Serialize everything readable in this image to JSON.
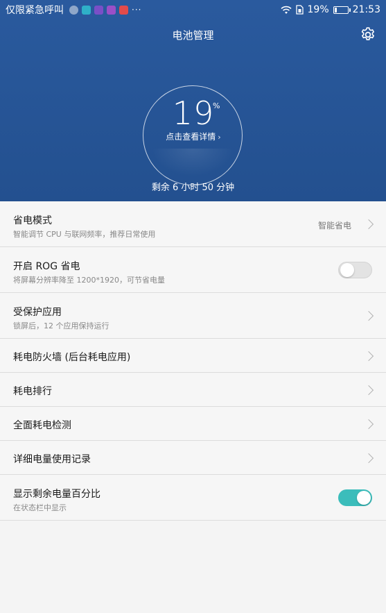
{
  "status_bar": {
    "carrier": "仅限紧急呼叫",
    "notification_icons": [
      {
        "name": "vpn-icon",
        "color": "#8fa7c9"
      },
      {
        "name": "app-icon-teal",
        "color": "#2fb0c8"
      },
      {
        "name": "app-icon-purple",
        "color": "#7a4fc7"
      },
      {
        "name": "app-icon-violet",
        "color": "#9b4fc7"
      },
      {
        "name": "app-icon-red",
        "color": "#e24b4b"
      }
    ],
    "more": "···",
    "battery_percent": "19%",
    "battery_level": 0.19,
    "time": "21:53"
  },
  "header": {
    "title": "电池管理",
    "battery_value": "19",
    "percent_sign": "%",
    "detail_link": "点击查看详情",
    "detail_chevron": "›",
    "remaining": "剩余 6 小时 50 分钟",
    "accent_color": "#2a5a9e"
  },
  "settings": {
    "power_saving_mode": {
      "title": "省电模式",
      "subtitle": "智能调节 CPU 与联网频率，推荐日常使用",
      "value": "智能省电"
    },
    "rog": {
      "title": "开启 ROG 省电",
      "subtitle": "将屏幕分辨率降至 1200*1920，可节省电量",
      "enabled": false
    },
    "protected_apps": {
      "title": "受保护应用",
      "subtitle": "锁屏后，12 个应用保持运行"
    },
    "firewall": {
      "title": "耗电防火墙 (后台耗电应用)"
    },
    "ranking": {
      "title": "耗电排行"
    },
    "full_check": {
      "title": "全面耗电检测"
    },
    "usage_record": {
      "title": "详细电量使用记录"
    },
    "show_percentage": {
      "title": "显示剩余电量百分比",
      "subtitle": "在状态栏中显示",
      "enabled": true
    },
    "toggle_on_color": "#3bbdbb"
  }
}
